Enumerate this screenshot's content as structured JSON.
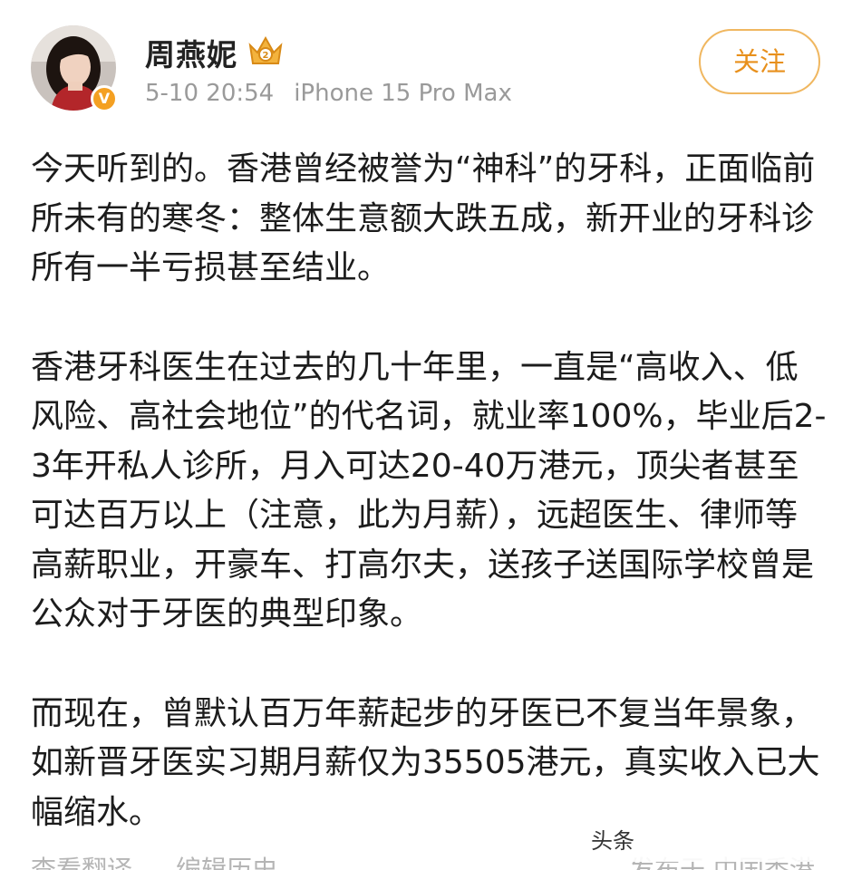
{
  "author": {
    "name": "周燕妮",
    "verified_mark": "V",
    "avatar_icon": "user-avatar-photo",
    "vip_icon": "crown-badge-icon"
  },
  "post_meta": {
    "time": "5-10 20:54",
    "device": "iPhone 15 Pro Max"
  },
  "follow_button": {
    "label": "关注"
  },
  "post": {
    "paragraphs": [
      "今天听到的。香港曾经被誉为“神科”的牙科，正面临前所未有的寒冬：整体生意额大跌五成，新开业的牙科诊所有一半亏损甚至结业。",
      "香港牙科医生在过去的几十年里，一直是“高收入、低风险、高社会地位”的代名词，就业率100%，毕业后2-3年开私人诊所，月入可达20-40万港元，顶尖者甚至可达百万以上（注意，此为月薪），远超医生、律师等高薪职业，开豪车、打高尔夫，送孩子送国际学校曾是公众对于牙医的典型印象。",
      "而现在，曾默认百万年薪起步的牙医已不复当年景象，如新晋牙医实习期月薪仅为35505港元，真实收入已大幅缩水。"
    ]
  },
  "footer": {
    "translate_label": "查看翻译",
    "history_label": "编辑历史",
    "location_label": "发布于 中国香港"
  },
  "watermark": {
    "text": "头条"
  },
  "colors": {
    "accent": "#e8901c",
    "follow_border": "#f0b760",
    "meta_text": "#9a9a9a",
    "body_text": "#1c1c1c"
  }
}
